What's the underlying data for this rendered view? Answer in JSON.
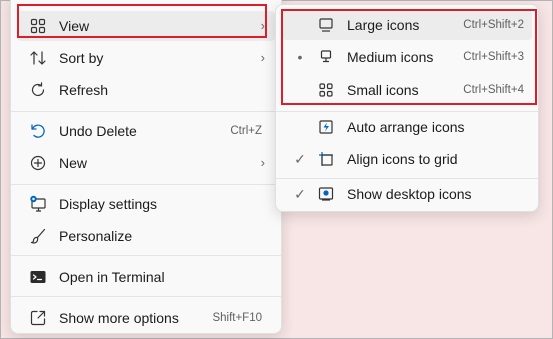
{
  "main_menu": {
    "items": [
      {
        "label": "View",
        "icon": "view-grid-icon",
        "submenu": true
      },
      {
        "label": "Sort by",
        "icon": "sort-icon",
        "submenu": true
      },
      {
        "label": "Refresh",
        "icon": "refresh-icon"
      },
      {
        "label": "Undo Delete",
        "icon": "undo-icon",
        "shortcut": "Ctrl+Z"
      },
      {
        "label": "New",
        "icon": "new-plus-icon",
        "submenu": true
      },
      {
        "label": "Display settings",
        "icon": "display-settings-icon"
      },
      {
        "label": "Personalize",
        "icon": "personalize-brush-icon"
      },
      {
        "label": "Open in Terminal",
        "icon": "terminal-icon"
      },
      {
        "label": "Show more options",
        "icon": "show-more-options-icon",
        "shortcut": "Shift+F10"
      }
    ]
  },
  "view_submenu": {
    "items": [
      {
        "label": "Large icons",
        "icon": "monitor-icon",
        "shortcut": "Ctrl+Shift+2",
        "selected": false
      },
      {
        "label": "Medium icons",
        "icon": "monitor-stand-icon",
        "shortcut": "Ctrl+Shift+3",
        "selected": true
      },
      {
        "label": "Small icons",
        "icon": "small-grid-icon",
        "shortcut": "Ctrl+Shift+4",
        "selected": false
      },
      {
        "label": "Auto arrange icons",
        "icon": "auto-arrange-icon",
        "checked": false
      },
      {
        "label": "Align icons to grid",
        "icon": "align-grid-icon",
        "checked": true
      },
      {
        "label": "Show desktop icons",
        "icon": "show-desktop-icon",
        "checked": true
      }
    ]
  },
  "glyphs": {
    "chevron": "›",
    "bullet": "•",
    "check": "✓"
  },
  "colors": {
    "highlight_box": "#dc1e2b",
    "desktop_background": "#f8e6e6",
    "menu_background": "#f9f9f9",
    "accent_blue": "#0067c0"
  }
}
